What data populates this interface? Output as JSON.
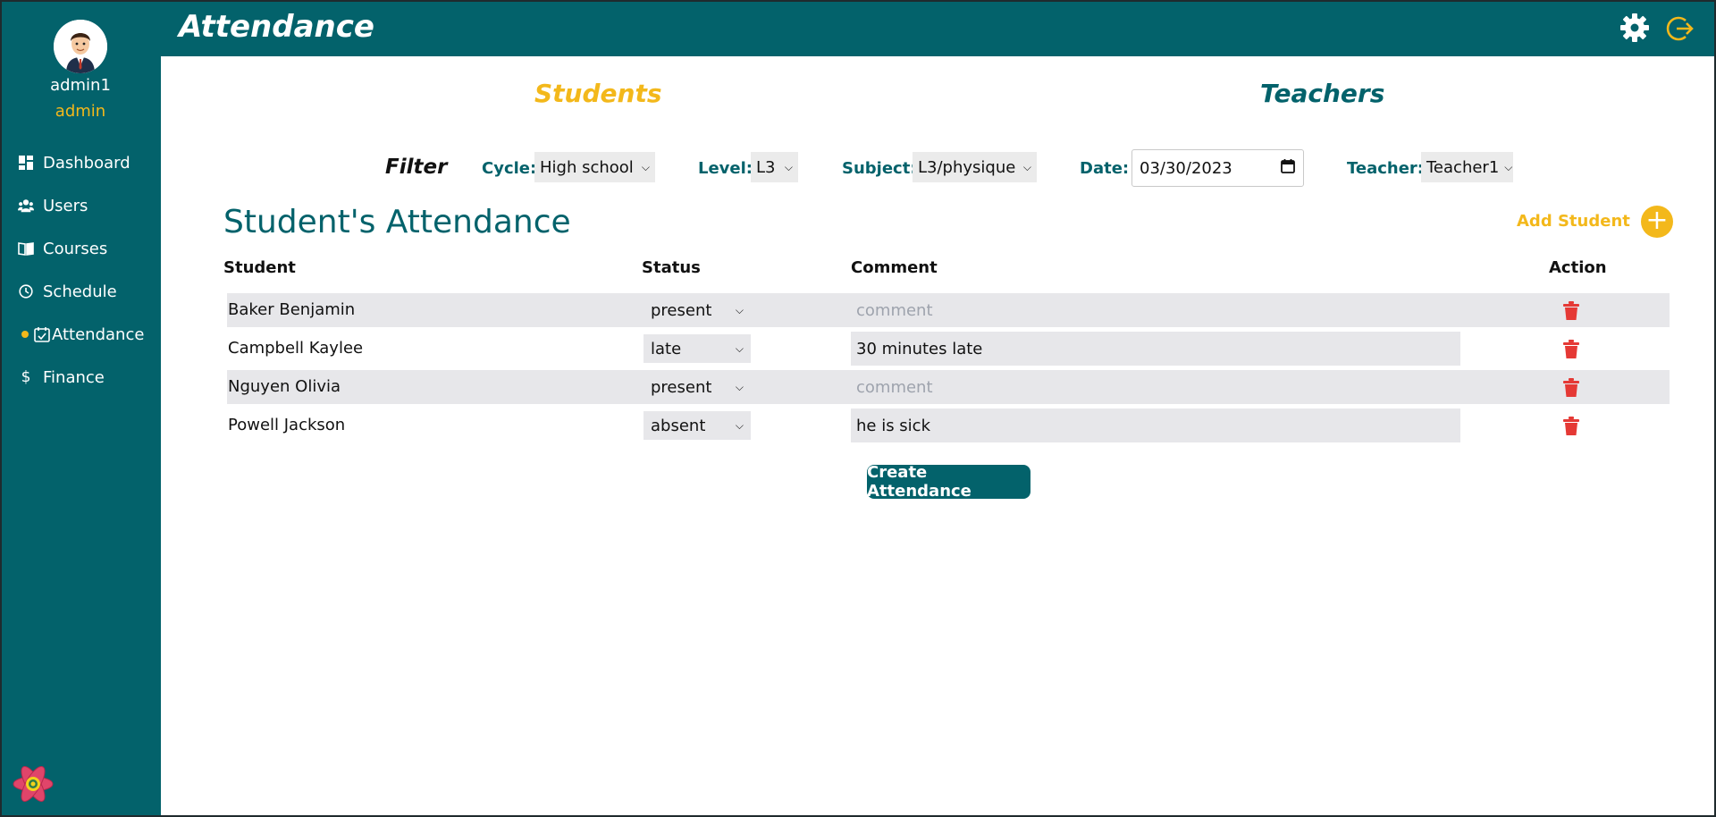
{
  "header": {
    "title": "Attendance"
  },
  "user": {
    "name": "admin1",
    "role": "admin"
  },
  "sidebar": {
    "items": [
      {
        "label": "Dashboard",
        "icon": "dashboard-icon"
      },
      {
        "label": "Users",
        "icon": "users-icon"
      },
      {
        "label": "Courses",
        "icon": "book-icon"
      },
      {
        "label": "Schedule",
        "icon": "clock-icon"
      },
      {
        "label": "Attendance",
        "icon": "calendar-check-icon",
        "active": true
      },
      {
        "label": "Finance",
        "icon": "dollar-icon"
      }
    ]
  },
  "tabs": {
    "students": "Students",
    "teachers": "Teachers"
  },
  "filter": {
    "title": "Filter",
    "cycle_label": "Cycle:",
    "cycle_value": "High school",
    "level_label": "Level:",
    "level_value": "L3",
    "subject_label": "Subject:",
    "subject_value": "L3/physique",
    "date_label": "Date:",
    "date_value": "03/30/2023",
    "teacher_label": "Teacher:",
    "teacher_value": "Teacher1"
  },
  "section": {
    "title": "Student's Attendance",
    "add_label": "Add Student"
  },
  "table": {
    "headers": {
      "student": "Student",
      "status": "Status",
      "comment": "Comment",
      "action": "Action"
    },
    "comment_placeholder": "comment",
    "rows": [
      {
        "student": "Baker Benjamin",
        "status": "present",
        "comment": ""
      },
      {
        "student": "Campbell Kaylee",
        "status": "late",
        "comment": "30 minutes late"
      },
      {
        "student": "Nguyen Olivia",
        "status": "present",
        "comment": ""
      },
      {
        "student": "Powell Jackson",
        "status": "absent",
        "comment": "he is sick"
      }
    ]
  },
  "actions": {
    "create": "Create Attendance"
  },
  "colors": {
    "primary": "#03626b",
    "accent": "#f3b81b",
    "danger": "#e53935",
    "row_shade": "#e7e7ea"
  }
}
